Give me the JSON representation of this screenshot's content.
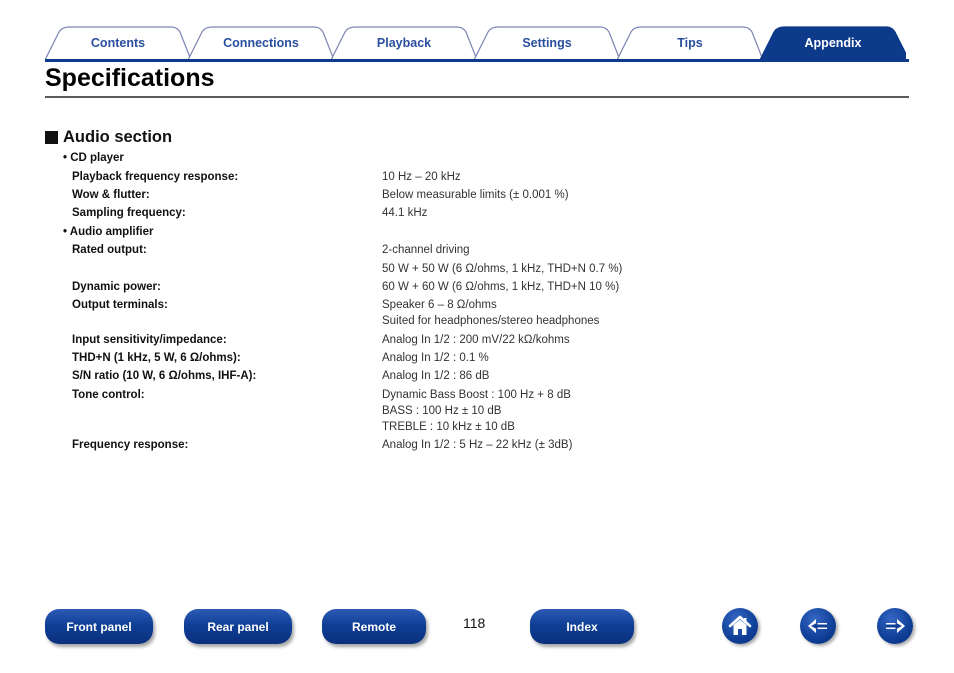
{
  "tabs": [
    {
      "label": "Contents",
      "active": false
    },
    {
      "label": "Connections",
      "active": false
    },
    {
      "label": "Playback",
      "active": false
    },
    {
      "label": "Settings",
      "active": false
    },
    {
      "label": "Tips",
      "active": false
    },
    {
      "label": "Appendix",
      "active": true
    }
  ],
  "colors": {
    "accent": "#0d3a8a",
    "tab_text": "#2a4f9e"
  },
  "page_title": "Specifications",
  "section": {
    "title": "Audio section",
    "cd_player": {
      "heading": "• CD player",
      "rows": [
        {
          "label": "Playback frequency response:",
          "value": "10 Hz – 20 kHz"
        },
        {
          "label": "Wow & flutter:",
          "value": "Below measurable limits (± 0.001 %)"
        },
        {
          "label": "Sampling frequency:",
          "value": "44.1 kHz"
        }
      ]
    },
    "audio_amplifier": {
      "heading": "• Audio amplifier",
      "rows": [
        {
          "label": "Rated output:",
          "values": [
            "2-channel driving",
            "50 W + 50 W (6 Ω/ohms, 1 kHz, THD+N 0.7 %)"
          ]
        },
        {
          "label": "Dynamic power:",
          "values": [
            "60 W + 60 W (6 Ω/ohms, 1 kHz, THD+N 10 %)"
          ]
        },
        {
          "label": "Output terminals:",
          "values": [
            "Speaker 6 – 8 Ω/ohms",
            "Suited for headphones/stereo headphones"
          ]
        },
        {
          "label": "Input sensitivity/impedance:",
          "values": [
            "Analog In 1/2 : 200 mV/22 kΩ/kohms"
          ]
        },
        {
          "label": "THD+N (1 kHz, 5 W, 6 Ω/ohms):",
          "values": [
            "Analog In 1/2 : 0.1 %"
          ]
        },
        {
          "label": "S/N ratio (10 W, 6 Ω/ohms, IHF-A):",
          "values": [
            "Analog In 1/2 : 86 dB"
          ]
        },
        {
          "label": "Tone control:",
          "values": [
            "Dynamic Bass Boost : 100 Hz + 8 dB",
            "BASS : 100 Hz ± 10 dB",
            "TREBLE : 10 kHz ± 10 dB"
          ]
        },
        {
          "label": "Frequency response:",
          "values": [
            "Analog In 1/2 : 5 Hz – 22 kHz (± 3dB)"
          ]
        }
      ]
    }
  },
  "footer": {
    "buttons": [
      "Front panel",
      "Rear panel",
      "Remote",
      "Index"
    ],
    "page_number": "118",
    "icons": [
      "home-icon",
      "back-arrow-icon",
      "forward-arrow-icon"
    ]
  }
}
